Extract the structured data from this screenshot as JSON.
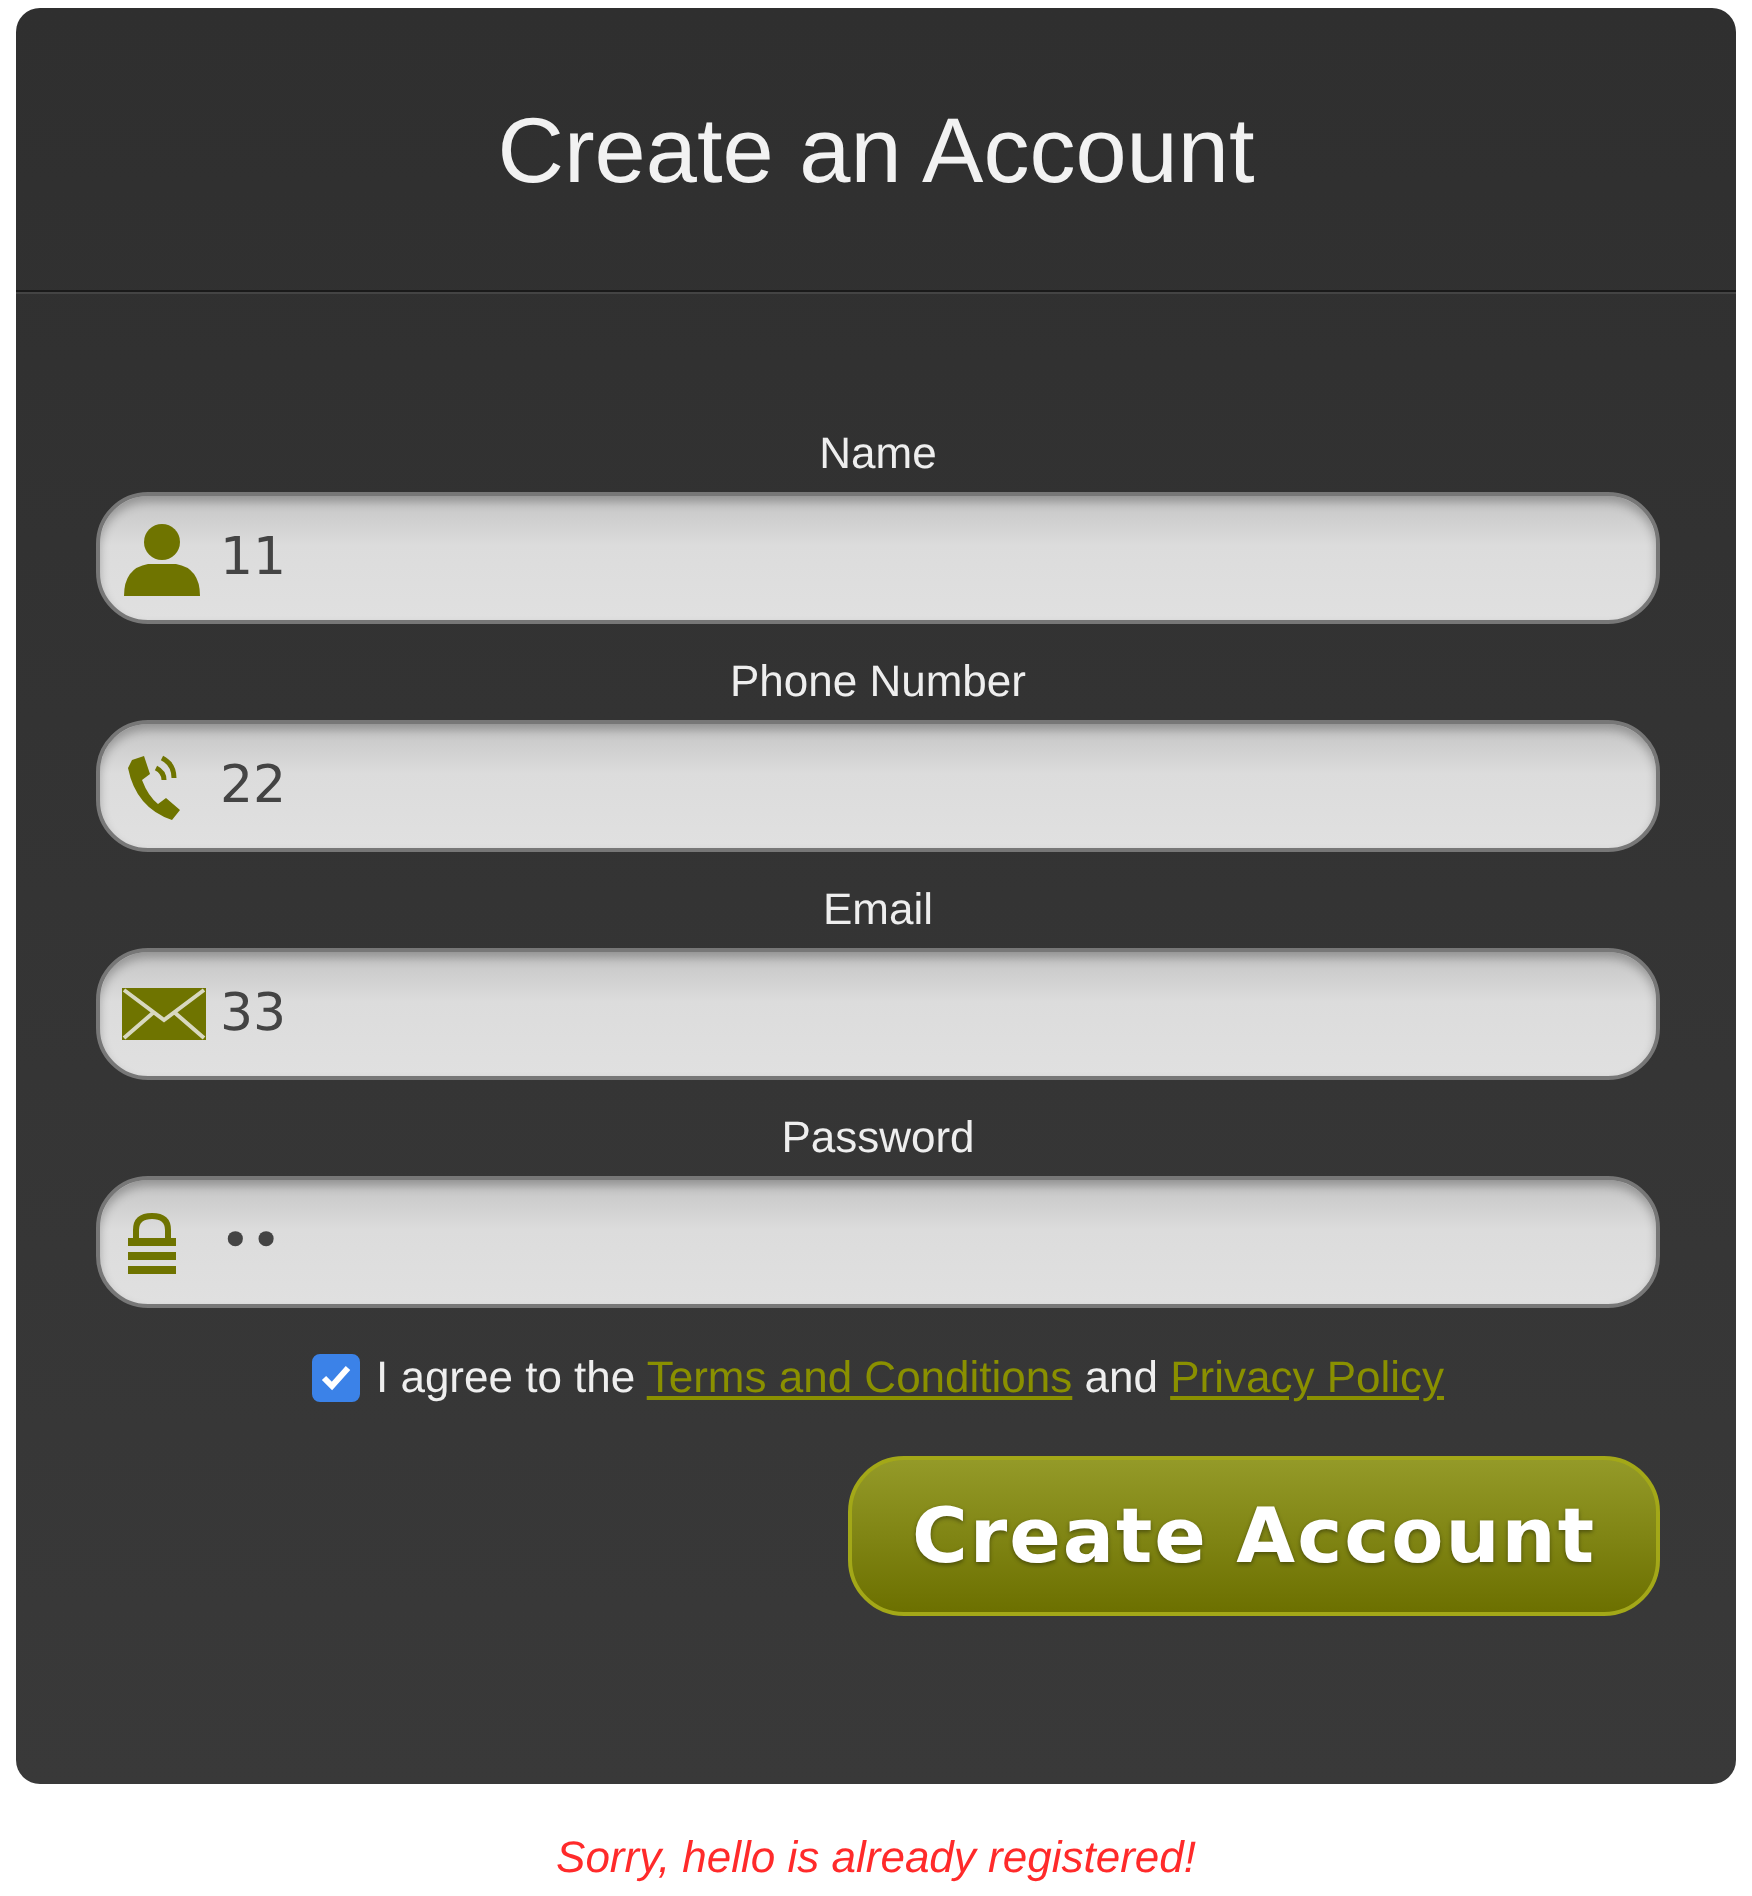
{
  "title": "Create an Account",
  "fields": [
    {
      "kind": "person",
      "label": "Name",
      "value": "11"
    },
    {
      "kind": "phone",
      "label": "Phone Number",
      "value": "22"
    },
    {
      "kind": "mail",
      "label": "Email",
      "value": "33"
    },
    {
      "kind": "lock",
      "label": "Password",
      "value": "••"
    }
  ],
  "agreement": {
    "checked": true,
    "parts": [
      {
        "kind": "text",
        "text": "I agree to the "
      },
      {
        "kind": "link",
        "text": "Terms and Conditions"
      },
      {
        "kind": "text",
        "text": " and "
      },
      {
        "kind": "link",
        "text": "Privacy Policy"
      }
    ]
  },
  "submit": "Create Account",
  "error": "Sorry, hello is already registered!"
}
